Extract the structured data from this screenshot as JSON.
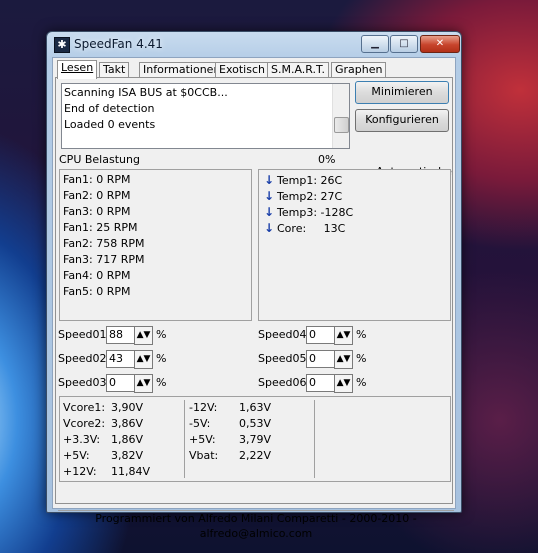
{
  "window": {
    "title": "SpeedFan 4.41",
    "controls": {
      "minimize": "▁",
      "maximize": "□",
      "close": "✕"
    }
  },
  "tabs": [
    "Lesen",
    "Takt",
    "Informationen",
    "Exotisch",
    "S.M.A.R.T.",
    "Graphen"
  ],
  "active_tab": "Lesen",
  "log_lines": [
    "Scanning ISA BUS at $0CCB...",
    "End of detection",
    "Loaded 0 events"
  ],
  "buttons": {
    "minimize": "Minimieren",
    "configure": "Konfigurieren"
  },
  "auto_fan": {
    "label": "Automatische Lüftergeschwindigkeit",
    "checked": true
  },
  "cpu_usage": {
    "label": "CPU Belastung",
    "value": "0%"
  },
  "fans": [
    "Fan1: 0 RPM",
    "Fan2: 0 RPM",
    "Fan3: 0 RPM",
    "Fan1: 25 RPM",
    "Fan2: 758 RPM",
    "Fan3: 717 RPM",
    "Fan4: 0 RPM",
    "Fan5: 0 RPM"
  ],
  "temps": [
    {
      "label": "Temp1: 26C",
      "trend": "down"
    },
    {
      "label": "Temp2: 27C",
      "trend": "down"
    },
    {
      "label": "Temp3: -128C",
      "trend": "down"
    },
    {
      "label": "Core:     13C",
      "trend": "down"
    }
  ],
  "speeds": [
    {
      "label": "Speed01:",
      "value": "88",
      "unit": "%"
    },
    {
      "label": "Speed02:",
      "value": "43",
      "unit": "%"
    },
    {
      "label": "Speed03:",
      "value": "0",
      "unit": "%"
    },
    {
      "label": "Speed04:",
      "value": "0",
      "unit": "%"
    },
    {
      "label": "Speed05:",
      "value": "0",
      "unit": "%"
    },
    {
      "label": "Speed06:",
      "value": "0",
      "unit": "%"
    }
  ],
  "voltages_left": [
    {
      "name": "Vcore1:",
      "value": "3,90V"
    },
    {
      "name": "Vcore2:",
      "value": "3,86V"
    },
    {
      "name": "+3.3V:",
      "value": "1,86V"
    },
    {
      "name": "+5V:",
      "value": "3,82V"
    },
    {
      "name": "+12V:",
      "value": "11,84V"
    }
  ],
  "voltages_right": [
    {
      "name": "-12V:",
      "value": "1,63V"
    },
    {
      "name": "-5V:",
      "value": "0,53V"
    },
    {
      "name": "+5V:",
      "value": "3,79V"
    },
    {
      "name": "Vbat:",
      "value": "2,22V"
    }
  ],
  "status_text": "Programmiert von Alfredo Milani Comparetti - 2000-2010 - alfredo@almico.com"
}
